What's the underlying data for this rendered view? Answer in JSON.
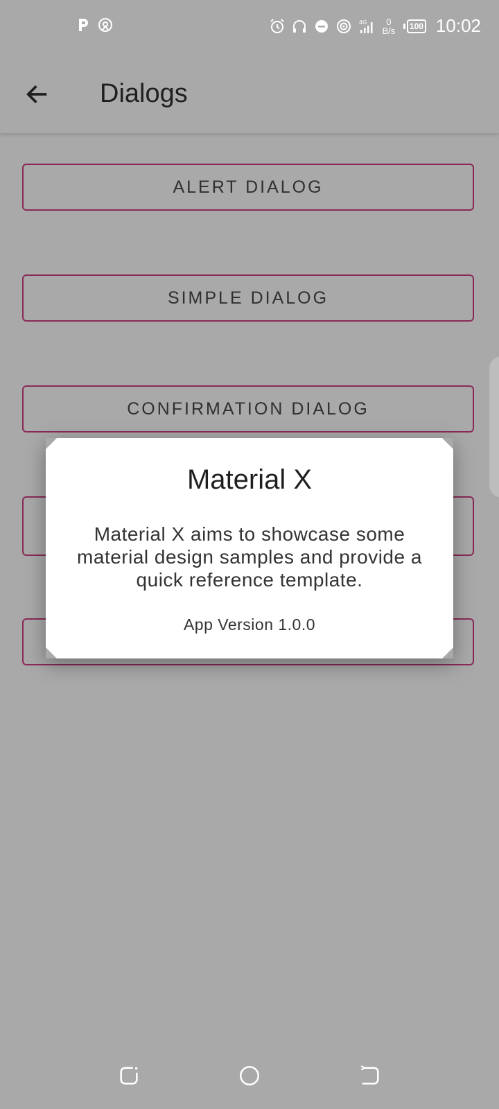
{
  "status_bar": {
    "time": "10:02",
    "net_speed_value": "0",
    "net_speed_unit": "B/s",
    "battery": "100",
    "network": "4G",
    "left_icons": [
      "parking-app-icon",
      "hotspot-app-icon"
    ],
    "right_icons": [
      "alarm-icon",
      "headset-icon",
      "do-not-disturb-icon",
      "hotspot-icon",
      "signal-icon"
    ]
  },
  "app_bar": {
    "title": "Dialogs"
  },
  "buttons": [
    {
      "label": "ALERT DIALOG"
    },
    {
      "label": "SIMPLE DIALOG"
    },
    {
      "label": "CONFIRMATION DIALOG"
    }
  ],
  "dialog": {
    "title": "Material X",
    "message": "Material X aims to showcase some material design samples and provide a quick reference template.",
    "version": "App Version 1.0.0"
  },
  "colors": {
    "scrim": "#a9a9a9",
    "button_border": "#8a2a58",
    "dialog_bg": "#ffffff"
  }
}
